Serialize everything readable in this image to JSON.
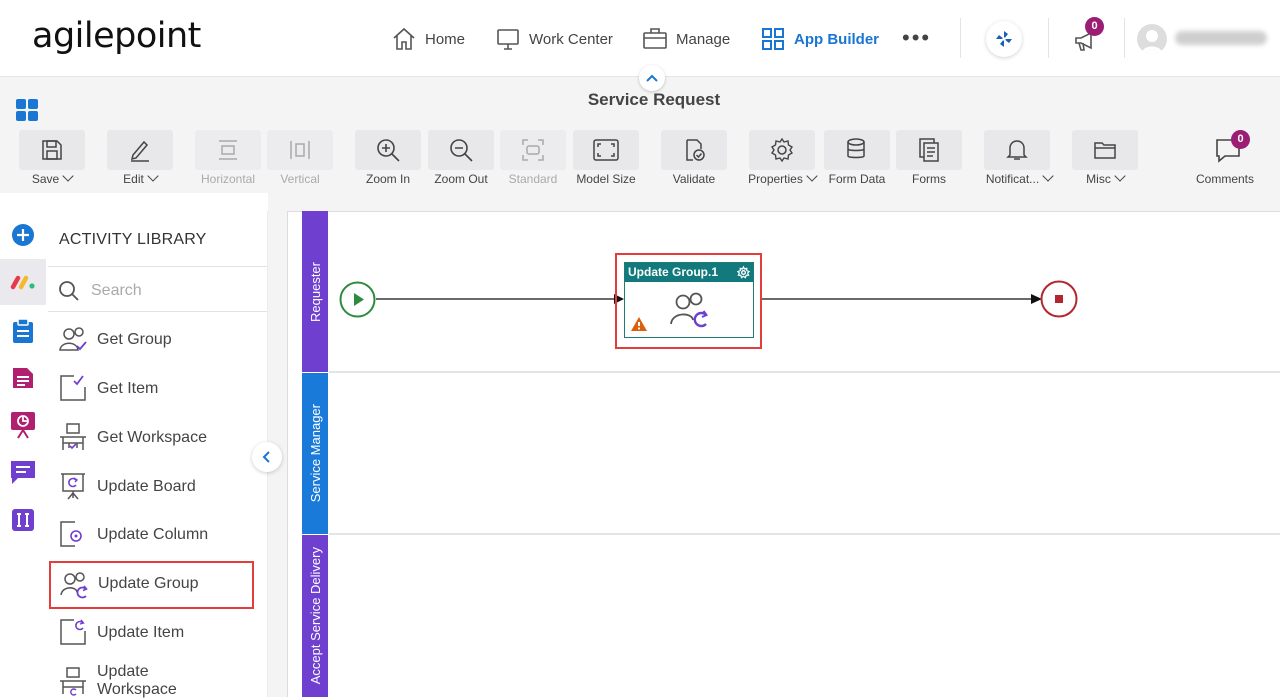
{
  "logo": {
    "text": "agilepoint"
  },
  "nav": {
    "home": "Home",
    "work_center": "Work Center",
    "manage": "Manage",
    "app_builder": "App Builder",
    "more": "•••"
  },
  "notifications": {
    "count": "0"
  },
  "page": {
    "title": "Service Request"
  },
  "toolbar": {
    "save": "Save",
    "edit": "Edit",
    "horizontal": "Horizontal",
    "vertical": "Vertical",
    "zoom_in": "Zoom In",
    "zoom_out": "Zoom Out",
    "standard": "Standard",
    "model_size": "Model Size",
    "validate": "Validate",
    "properties": "Properties",
    "form_data": "Form Data",
    "forms": "Forms",
    "notifications": "Notificat...",
    "misc": "Misc",
    "comments": "Comments",
    "comments_count": "0"
  },
  "library": {
    "title": "ACTIVITY LIBRARY",
    "search_placeholder": "Search",
    "items": [
      {
        "label": "Get Group"
      },
      {
        "label": "Get Item"
      },
      {
        "label": "Get Workspace"
      },
      {
        "label": "Update Board"
      },
      {
        "label": "Update Column"
      },
      {
        "label": "Update Group"
      },
      {
        "label": "Update Item"
      },
      {
        "label": "Update Workspace"
      }
    ]
  },
  "lanes": [
    {
      "name": "Requester",
      "color": "#6f3fcf"
    },
    {
      "name": "Service Manager",
      "color": "#1a7ad9"
    },
    {
      "name": "Accept Service Delivery",
      "color": "#6f3fcf"
    }
  ],
  "task": {
    "title": "Update Group.1"
  },
  "colors": {
    "accent": "#1976d2",
    "badge": "#9c1d74",
    "highlight": "#e33d3d",
    "task_header": "#127a7c",
    "start": "#2e8b3e",
    "end": "#b3262e"
  }
}
